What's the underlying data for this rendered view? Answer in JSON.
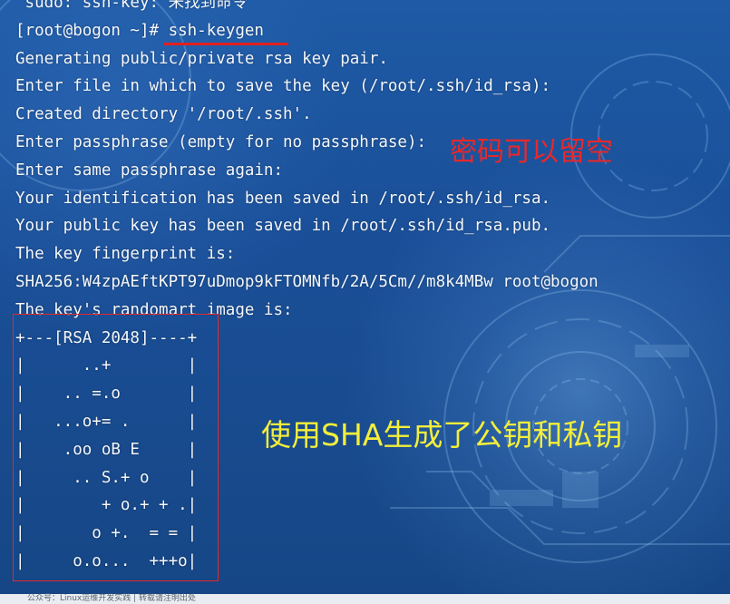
{
  "terminal": {
    "top_partial": " sudo: ssh-key: 未找到命令",
    "prompt_user_host": "[root@bogon ~]# ",
    "command": "ssh-keygen",
    "lines": [
      "Generating public/private rsa key pair.",
      "Enter file in which to save the key (/root/.ssh/id_rsa):",
      "Created directory '/root/.ssh'.",
      "Enter passphrase (empty for no passphrase):",
      "Enter same passphrase again:",
      "Your identification has been saved in /root/.ssh/id_rsa.",
      "Your public key has been saved in /root/.ssh/id_rsa.pub.",
      "The key fingerprint is:",
      "SHA256:W4zpAEftKPT97uDmop9kFTOMNfb/2A/5Cm//m8k4MBw root@bogon",
      "The key's randomart image is:"
    ],
    "randomart": [
      "+---[RSA 2048]----+",
      "|      ..+        |",
      "|    .. =.o       |",
      "|   ...o+= .      |",
      "|    .oo oB E     |",
      "|     .. S.+ o    |",
      "|        + o.+ + .|",
      "|       o +.  = = |",
      "|     o.o...  +++o|"
    ]
  },
  "annotations": {
    "passphrase_note": "密码可以留空",
    "keys_note": "使用SHA生成了公钥和私钥"
  },
  "taskbar": {
    "text": "公众号：Linux运维开发实践 | 转载请注明出处"
  },
  "colors": {
    "background": "#1a4f98",
    "terminal_text": "#f4f7fb",
    "highlight_red": "#e02020",
    "note_yellow": "#f3ee3a"
  }
}
